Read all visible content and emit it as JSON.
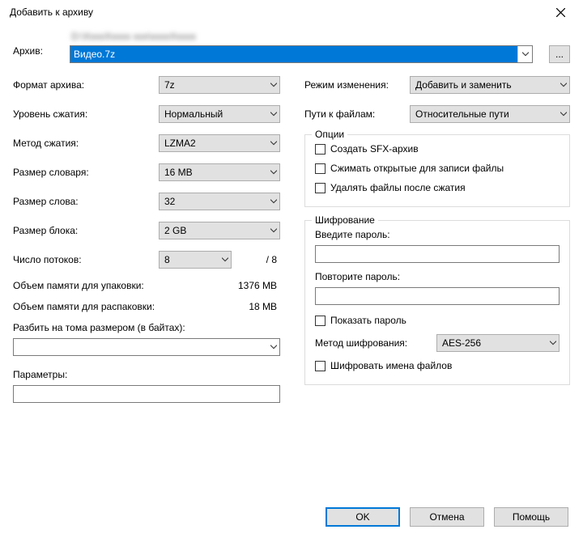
{
  "window": {
    "title": "Добавить к архиву"
  },
  "archive": {
    "label": "Архив:",
    "path_blurred": "D:\\XxxxXxxxx xxx\\xxxxXxxxx",
    "filename": "Видео.7z",
    "browse": "..."
  },
  "left": {
    "format": {
      "label": "Формат архива:",
      "value": "7z"
    },
    "level": {
      "label": "Уровень сжатия:",
      "value": "Нормальный"
    },
    "method": {
      "label": "Метод сжатия:",
      "value": "LZMA2"
    },
    "dict": {
      "label": "Размер словаря:",
      "value": "16 MB"
    },
    "word": {
      "label": "Размер слова:",
      "value": "32"
    },
    "block": {
      "label": "Размер блока:",
      "value": "2 GB"
    },
    "threads": {
      "label": "Число потоков:",
      "value": "8",
      "max": "/ 8"
    },
    "mem_pack": {
      "label": "Объем памяти для упаковки:",
      "value": "1376 MB"
    },
    "mem_unpack": {
      "label": "Объем памяти для распаковки:",
      "value": "18 MB"
    },
    "split": {
      "label": "Разбить на тома размером (в байтах):",
      "value": ""
    },
    "params": {
      "label": "Параметры:",
      "value": ""
    }
  },
  "right": {
    "update": {
      "label": "Режим изменения:",
      "value": "Добавить и заменить"
    },
    "paths": {
      "label": "Пути к файлам:",
      "value": "Относительные пути"
    },
    "options": {
      "legend": "Опции",
      "sfx": "Создать SFX-архив",
      "shared": "Сжимать открытые для записи файлы",
      "delete": "Удалять файлы после сжатия"
    },
    "encryption": {
      "legend": "Шифрование",
      "pass": "Введите пароль:",
      "repass": "Повторите пароль:",
      "show": "Показать пароль",
      "method_label": "Метод шифрования:",
      "method_value": "AES-256",
      "encnames": "Шифровать имена файлов"
    }
  },
  "buttons": {
    "ok": "OK",
    "cancel": "Отмена",
    "help": "Помощь"
  }
}
